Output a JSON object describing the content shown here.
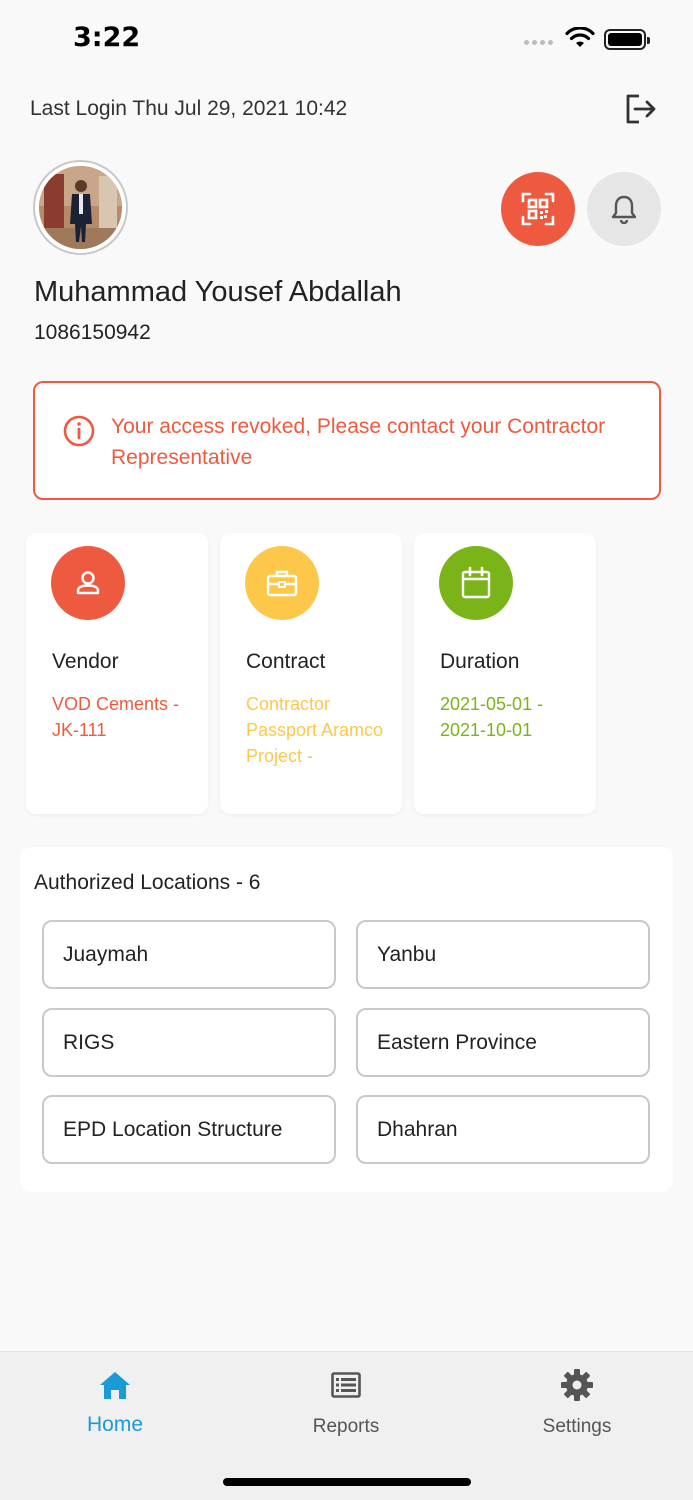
{
  "status_bar": {
    "time": "3:22"
  },
  "header": {
    "last_login": "Last Login Thu Jul 29, 2021 10:42"
  },
  "profile": {
    "name": "Muhammad Yousef Abdallah",
    "id": "1086150942"
  },
  "alert": {
    "message": "Your access revoked, Please contact your Contractor Representative",
    "color": "#ee5a3f"
  },
  "cards": [
    {
      "title": "Vendor",
      "value": "VOD Cements - JK-111",
      "color": "#ee5a3f",
      "icon": "person-icon"
    },
    {
      "title": "Contract",
      "value": "Contractor Passport Aramco Project -",
      "color": "#fdc84a",
      "icon": "briefcase-icon"
    },
    {
      "title": "Duration",
      "value": "2021-05-01 - 2021-10-01",
      "color": "#7bb418",
      "icon": "calendar-icon"
    }
  ],
  "locations": {
    "title": "Authorized Locations - 6",
    "items": [
      "Juaymah",
      "Yanbu",
      "RIGS",
      "Eastern Province",
      "EPD Location Structure",
      "Dhahran"
    ]
  },
  "tabbar": {
    "items": [
      {
        "label": "Home",
        "icon": "home-icon",
        "active": true
      },
      {
        "label": "Reports",
        "icon": "list-icon",
        "active": false
      },
      {
        "label": "Settings",
        "icon": "gear-icon",
        "active": false
      }
    ],
    "active_color": "#1a9ad6"
  }
}
